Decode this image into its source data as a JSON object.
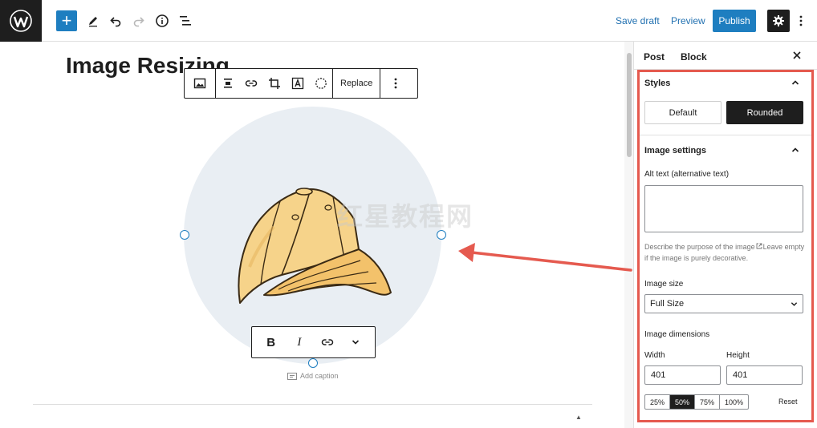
{
  "topbar": {
    "save_draft": "Save draft",
    "preview": "Preview",
    "publish": "Publish",
    "add_symbol": "+"
  },
  "editor": {
    "title": "Image Resizing",
    "image_toolbar": {
      "replace": "Replace"
    },
    "format_toolbar": {
      "bold": "B",
      "italic": "I"
    },
    "caption_placeholder": "Add caption",
    "watermark": "红星教程网"
  },
  "sidebar": {
    "tabs": [
      "Post",
      "Block"
    ],
    "styles": {
      "title": "Styles",
      "options": [
        "Default",
        "Rounded"
      ],
      "selected": "Rounded"
    },
    "image_settings": {
      "title": "Image settings",
      "alt_label": "Alt text (alternative text)",
      "alt_value": "",
      "help_line1": "Describe the purpose of the image",
      "help_line2": "Leave empty if the image is purely decorative.",
      "size_label": "Image size",
      "size_value": "Full Size",
      "dimensions_label": "Image dimensions",
      "width_label": "Width",
      "height_label": "Height",
      "width_value": "401",
      "height_value": "401",
      "percent_options": [
        "25%",
        "50%",
        "75%",
        "100%"
      ],
      "percent_selected": "50%",
      "reset": "Reset"
    }
  },
  "colors": {
    "accent": "#1e7ec0",
    "highlight": "#e55a4f",
    "dark": "#1e1e1e"
  }
}
